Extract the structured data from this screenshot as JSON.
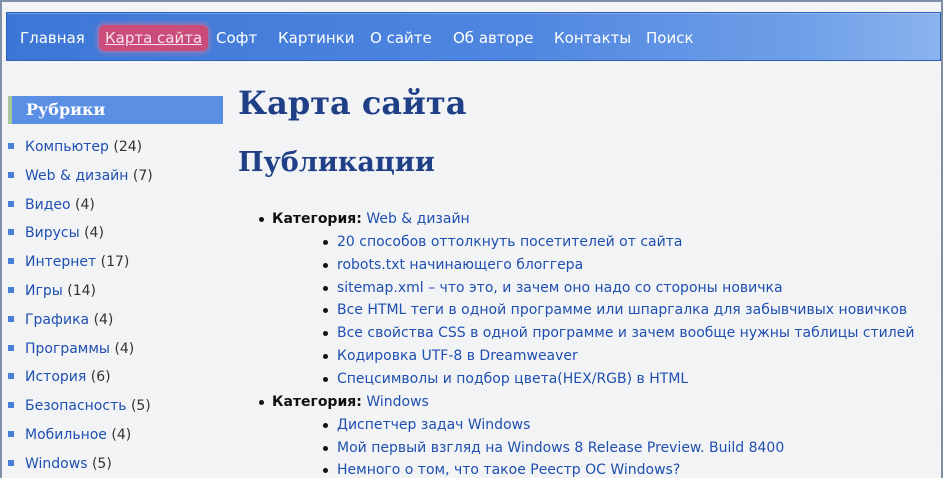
{
  "nav": {
    "items": [
      {
        "label": "Главная",
        "active": false
      },
      {
        "label": "Карта сайта",
        "active": true
      },
      {
        "label": "Софт",
        "active": false
      },
      {
        "label": "Картинки",
        "active": false
      },
      {
        "label": "О сайте",
        "active": false
      },
      {
        "label": "Об авторе",
        "active": false
      },
      {
        "label": "Контакты",
        "active": false
      },
      {
        "label": "Поиск",
        "active": false
      }
    ]
  },
  "sidebar": {
    "title": "Рубрики",
    "items": [
      {
        "label": "Компьютер",
        "count": "(24)"
      },
      {
        "label": "Web & дизайн",
        "count": "(7)"
      },
      {
        "label": "Видео",
        "count": "(4)"
      },
      {
        "label": "Вирусы",
        "count": "(4)"
      },
      {
        "label": "Интернет",
        "count": "(17)"
      },
      {
        "label": "Игры",
        "count": "(14)"
      },
      {
        "label": "Графика",
        "count": "(4)"
      },
      {
        "label": "Программы",
        "count": "(4)"
      },
      {
        "label": "История",
        "count": "(6)"
      },
      {
        "label": "Безопасность",
        "count": "(5)"
      },
      {
        "label": "Мобильное",
        "count": "(4)"
      },
      {
        "label": "Windows",
        "count": "(5)"
      }
    ]
  },
  "main": {
    "page_title": "Карта сайта",
    "section_title": "Публикации",
    "category_prefix": "Категория:",
    "categories": [
      {
        "name": "Web & дизайн",
        "posts": [
          "20 способов оттолкнуть посетителей от сайта",
          "robots.txt начинающего блоггера",
          "sitemap.xml – что это, и зачем оно надо со стороны новичка",
          "Все HTML теги в одной программе или шпаргалка для забывчивых новичков",
          "Все свойства CSS в одной программе и зачем вообще нужны таблицы стилей",
          "Кодировка UTF-8 в Dreamweaver",
          "Спецсимволы и подбор цвета(HEX/RGB) в HTML"
        ]
      },
      {
        "name": "Windows",
        "posts": [
          "Диспетчер задач Windows",
          "Мой первый взгляд на Windows 8 Release Preview. Build 8400",
          "Немного о том, что такое Реестр ОС Windows?"
        ]
      }
    ]
  },
  "colors": {
    "nav_bg": "#4f86e0",
    "active_tab": "#c94c7a",
    "heading": "#1f3f86",
    "link": "#1f4fb0",
    "sidebar_header": "#5a8fe3"
  }
}
